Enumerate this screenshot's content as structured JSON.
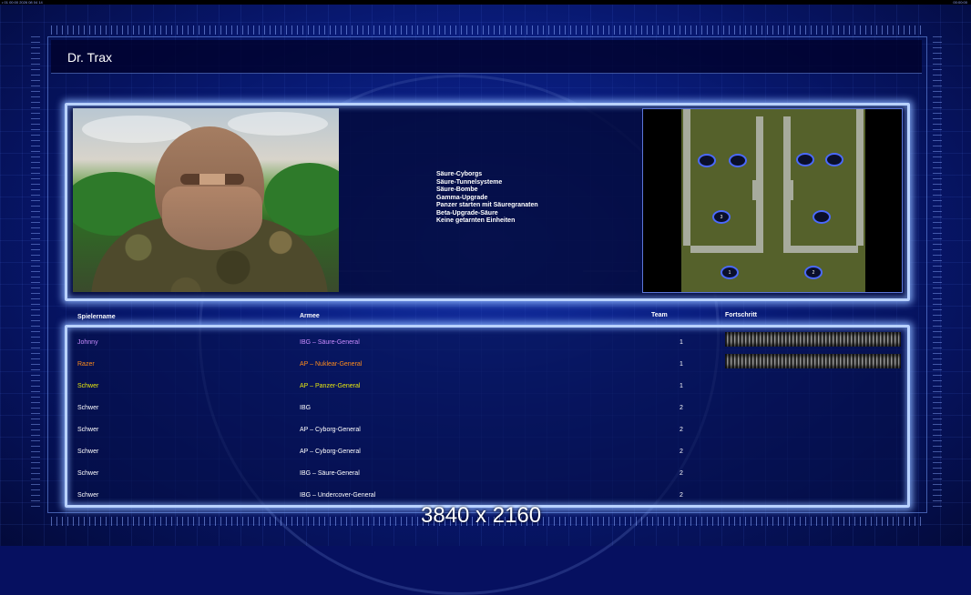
{
  "topbar": {
    "left_text": "• 01 00:00 2026 08 04 14",
    "right_text": "00:00:00"
  },
  "header": {
    "title": "Dr. Trax"
  },
  "objectives": [
    "Säure-Cyborgs",
    "Säure-Tunnelsysteme",
    "Säure-Bombe",
    "Gamma-Upgrade",
    "Panzer starten mit Säuregranaten",
    "Beta-Upgrade-Säure",
    "Keine getarnten Einheiten"
  ],
  "map": {
    "spot_labels": [
      "",
      "",
      "",
      "",
      "3",
      "",
      "1",
      "2"
    ]
  },
  "table": {
    "headers": {
      "name": "Spielername",
      "army": "Armee",
      "team": "Team",
      "progress": "Fortschritt"
    },
    "rows": [
      {
        "name": "Johnny",
        "army": "IBG – Säure-General",
        "team": "1",
        "color": "#c98cff",
        "progress": 1.0
      },
      {
        "name": "Razer",
        "army": "AP – Nuklear-General",
        "team": "1",
        "color": "#ff8c1a",
        "progress": 1.0
      },
      {
        "name": "Schwer",
        "army": "AP – Panzer-General",
        "team": "1",
        "color": "#e8e80e",
        "progress": null
      },
      {
        "name": "Schwer",
        "army": "IBG",
        "team": "2",
        "color": "#ffffff",
        "progress": null
      },
      {
        "name": "Schwer",
        "army": "AP – Cyborg-General",
        "team": "2",
        "color": "#ffffff",
        "progress": null
      },
      {
        "name": "Schwer",
        "army": "AP – Cyborg-General",
        "team": "2",
        "color": "#ffffff",
        "progress": null
      },
      {
        "name": "Schwer",
        "army": "IBG – Säure-General",
        "team": "2",
        "color": "#ffffff",
        "progress": null
      },
      {
        "name": "Schwer",
        "army": "IBG – Undercover-General",
        "team": "2",
        "color": "#ffffff",
        "progress": null
      }
    ]
  },
  "overlay": {
    "resolution_text": "3840 x 2160"
  }
}
